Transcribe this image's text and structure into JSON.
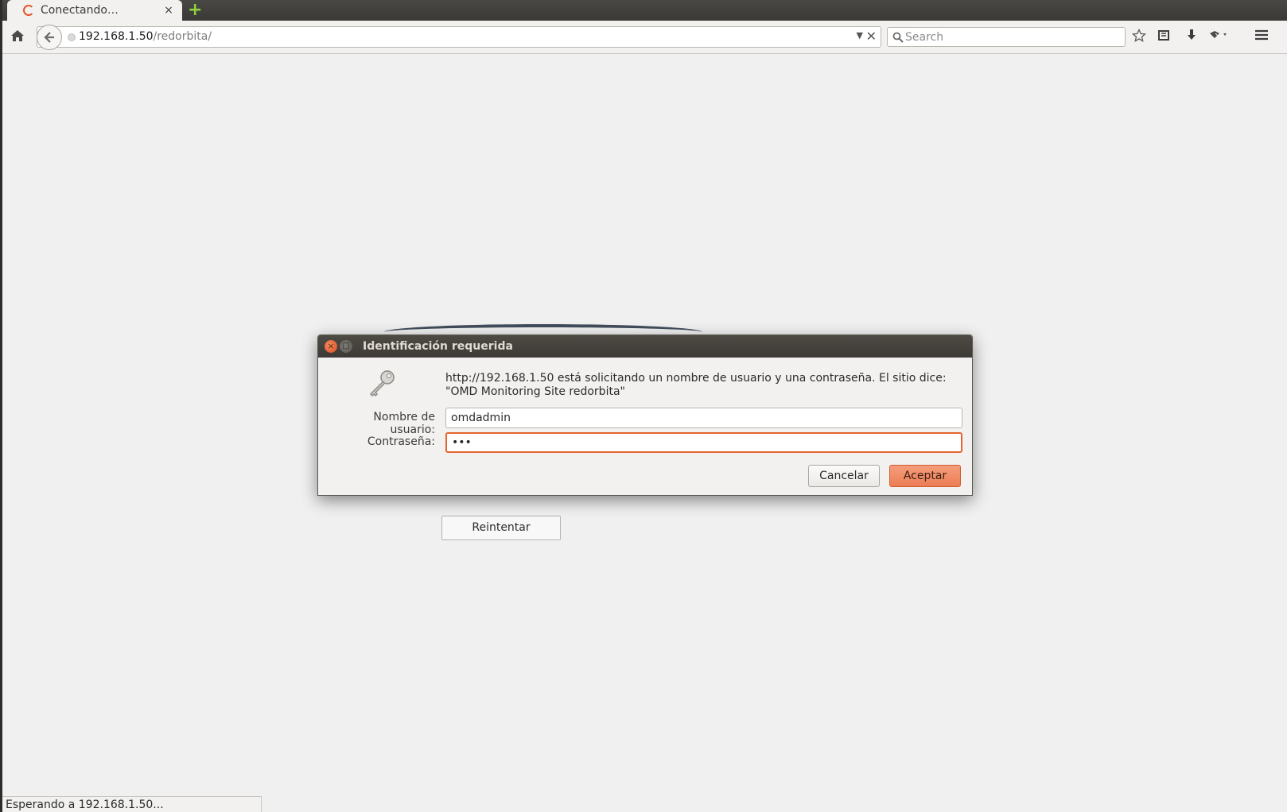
{
  "browser": {
    "tab": {
      "title": "Conectando…",
      "close_glyph": "×"
    },
    "new_tab_glyph": "+",
    "url": {
      "host": "192.168.1.50",
      "path": "/redorbita/"
    },
    "search_placeholder": "Search",
    "toolbar_icons": [
      "home-icon",
      "back-arrow-icon",
      "bookmark-star-icon",
      "reading-list-icon",
      "download-icon",
      "extensions-icon",
      "menu-icon"
    ]
  },
  "page": {
    "retry_label": "Reintentar"
  },
  "dialog": {
    "title": "Identificación requerida",
    "message": "http://192.168.1.50 está solicitando un nombre de usuario y una contraseña. El sitio dice: \"OMD Monitoring Site redorbita\"",
    "username_label": "Nombre de usuario:",
    "username_value": "omdadmin",
    "password_label": "Contraseña:",
    "password_value": "•••",
    "cancel_label": "Cancelar",
    "accept_label": "Aceptar",
    "accent_color": "#ec7d55"
  },
  "status": {
    "text": "Esperando a 192.168.1.50..."
  }
}
